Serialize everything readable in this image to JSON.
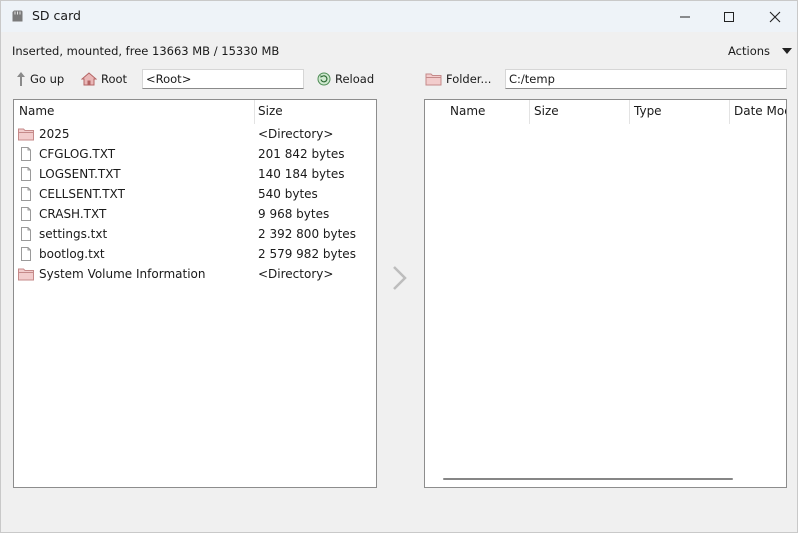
{
  "window": {
    "title": "SD card",
    "icon": "sd-card-icon"
  },
  "status_text": "Inserted, mounted, free 13663 MB / 15330 MB",
  "actions_label": "Actions",
  "toolbar_left": {
    "go_up_label": "Go up",
    "root_label": "Root",
    "path_value": "<Root>",
    "reload_label": "Reload"
  },
  "toolbar_right": {
    "folder_label": "Folder...",
    "path_value": "C:/temp"
  },
  "left_pane": {
    "columns": [
      "Name",
      "Size"
    ],
    "rows": [
      {
        "type": "folder",
        "name": "2025",
        "size": "<Directory>"
      },
      {
        "type": "file",
        "name": "CFGLOG.TXT",
        "size": "201 842 bytes"
      },
      {
        "type": "file",
        "name": "LOGSENT.TXT",
        "size": "140 184 bytes"
      },
      {
        "type": "file",
        "name": "CELLSENT.TXT",
        "size": "540 bytes"
      },
      {
        "type": "file",
        "name": "CRASH.TXT",
        "size": "9 968 bytes"
      },
      {
        "type": "file",
        "name": "settings.txt",
        "size": "2 392 800 bytes"
      },
      {
        "type": "file",
        "name": "bootlog.txt",
        "size": "2 579 982 bytes"
      },
      {
        "type": "folder",
        "name": "System Volume Information",
        "size": "<Directory>"
      }
    ]
  },
  "right_pane": {
    "columns": [
      "Name",
      "Size",
      "Type",
      "Date Mod"
    ]
  },
  "colors": {
    "titlebar": "#eef3f8",
    "folder": "#e8b8b8",
    "window_bg": "#f0f0f0"
  }
}
